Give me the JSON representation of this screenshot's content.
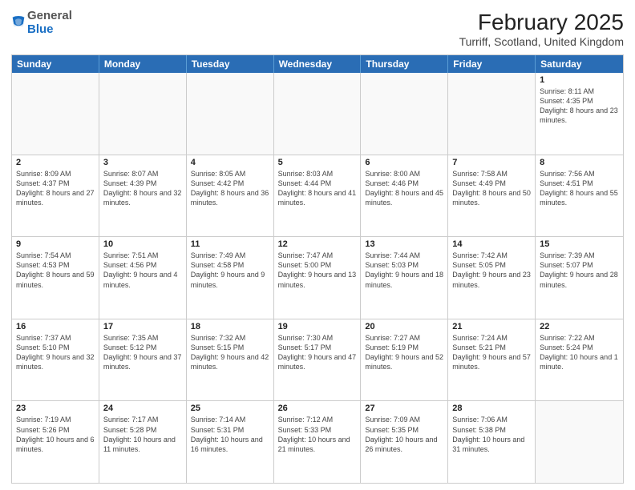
{
  "header": {
    "logo": {
      "general": "General",
      "blue": "Blue"
    },
    "title": "February 2025",
    "location": "Turriff, Scotland, United Kingdom"
  },
  "calendar": {
    "weekdays": [
      "Sunday",
      "Monday",
      "Tuesday",
      "Wednesday",
      "Thursday",
      "Friday",
      "Saturday"
    ],
    "rows": [
      [
        {
          "day": "",
          "text": ""
        },
        {
          "day": "",
          "text": ""
        },
        {
          "day": "",
          "text": ""
        },
        {
          "day": "",
          "text": ""
        },
        {
          "day": "",
          "text": ""
        },
        {
          "day": "",
          "text": ""
        },
        {
          "day": "1",
          "text": "Sunrise: 8:11 AM\nSunset: 4:35 PM\nDaylight: 8 hours and 23 minutes."
        }
      ],
      [
        {
          "day": "2",
          "text": "Sunrise: 8:09 AM\nSunset: 4:37 PM\nDaylight: 8 hours and 27 minutes."
        },
        {
          "day": "3",
          "text": "Sunrise: 8:07 AM\nSunset: 4:39 PM\nDaylight: 8 hours and 32 minutes."
        },
        {
          "day": "4",
          "text": "Sunrise: 8:05 AM\nSunset: 4:42 PM\nDaylight: 8 hours and 36 minutes."
        },
        {
          "day": "5",
          "text": "Sunrise: 8:03 AM\nSunset: 4:44 PM\nDaylight: 8 hours and 41 minutes."
        },
        {
          "day": "6",
          "text": "Sunrise: 8:00 AM\nSunset: 4:46 PM\nDaylight: 8 hours and 45 minutes."
        },
        {
          "day": "7",
          "text": "Sunrise: 7:58 AM\nSunset: 4:49 PM\nDaylight: 8 hours and 50 minutes."
        },
        {
          "day": "8",
          "text": "Sunrise: 7:56 AM\nSunset: 4:51 PM\nDaylight: 8 hours and 55 minutes."
        }
      ],
      [
        {
          "day": "9",
          "text": "Sunrise: 7:54 AM\nSunset: 4:53 PM\nDaylight: 8 hours and 59 minutes."
        },
        {
          "day": "10",
          "text": "Sunrise: 7:51 AM\nSunset: 4:56 PM\nDaylight: 9 hours and 4 minutes."
        },
        {
          "day": "11",
          "text": "Sunrise: 7:49 AM\nSunset: 4:58 PM\nDaylight: 9 hours and 9 minutes."
        },
        {
          "day": "12",
          "text": "Sunrise: 7:47 AM\nSunset: 5:00 PM\nDaylight: 9 hours and 13 minutes."
        },
        {
          "day": "13",
          "text": "Sunrise: 7:44 AM\nSunset: 5:03 PM\nDaylight: 9 hours and 18 minutes."
        },
        {
          "day": "14",
          "text": "Sunrise: 7:42 AM\nSunset: 5:05 PM\nDaylight: 9 hours and 23 minutes."
        },
        {
          "day": "15",
          "text": "Sunrise: 7:39 AM\nSunset: 5:07 PM\nDaylight: 9 hours and 28 minutes."
        }
      ],
      [
        {
          "day": "16",
          "text": "Sunrise: 7:37 AM\nSunset: 5:10 PM\nDaylight: 9 hours and 32 minutes."
        },
        {
          "day": "17",
          "text": "Sunrise: 7:35 AM\nSunset: 5:12 PM\nDaylight: 9 hours and 37 minutes."
        },
        {
          "day": "18",
          "text": "Sunrise: 7:32 AM\nSunset: 5:15 PM\nDaylight: 9 hours and 42 minutes."
        },
        {
          "day": "19",
          "text": "Sunrise: 7:30 AM\nSunset: 5:17 PM\nDaylight: 9 hours and 47 minutes."
        },
        {
          "day": "20",
          "text": "Sunrise: 7:27 AM\nSunset: 5:19 PM\nDaylight: 9 hours and 52 minutes."
        },
        {
          "day": "21",
          "text": "Sunrise: 7:24 AM\nSunset: 5:21 PM\nDaylight: 9 hours and 57 minutes."
        },
        {
          "day": "22",
          "text": "Sunrise: 7:22 AM\nSunset: 5:24 PM\nDaylight: 10 hours and 1 minute."
        }
      ],
      [
        {
          "day": "23",
          "text": "Sunrise: 7:19 AM\nSunset: 5:26 PM\nDaylight: 10 hours and 6 minutes."
        },
        {
          "day": "24",
          "text": "Sunrise: 7:17 AM\nSunset: 5:28 PM\nDaylight: 10 hours and 11 minutes."
        },
        {
          "day": "25",
          "text": "Sunrise: 7:14 AM\nSunset: 5:31 PM\nDaylight: 10 hours and 16 minutes."
        },
        {
          "day": "26",
          "text": "Sunrise: 7:12 AM\nSunset: 5:33 PM\nDaylight: 10 hours and 21 minutes."
        },
        {
          "day": "27",
          "text": "Sunrise: 7:09 AM\nSunset: 5:35 PM\nDaylight: 10 hours and 26 minutes."
        },
        {
          "day": "28",
          "text": "Sunrise: 7:06 AM\nSunset: 5:38 PM\nDaylight: 10 hours and 31 minutes."
        },
        {
          "day": "",
          "text": ""
        }
      ]
    ]
  }
}
